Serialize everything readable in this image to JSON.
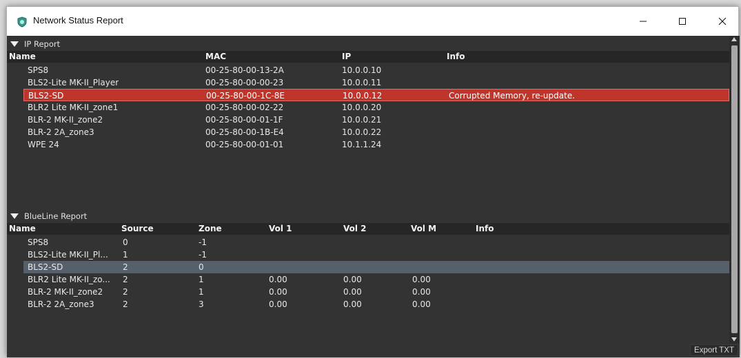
{
  "window": {
    "title": "Network Status Report",
    "icon": "network-shield-icon",
    "controls": {
      "minimize": "—",
      "maximize": "☐",
      "close": "✕"
    }
  },
  "ip_report": {
    "label": "IP Report",
    "columns": {
      "name": "Name",
      "mac": "MAC",
      "ip": "IP",
      "info": "Info"
    },
    "rows": [
      {
        "name": "SPS8",
        "mac": "00-25-80-00-13-2A",
        "ip": "10.0.0.10",
        "info": ""
      },
      {
        "name": "BLS2-Lite MK-II_Player",
        "mac": "00-25-80-00-00-23",
        "ip": "10.0.0.11",
        "info": ""
      },
      {
        "name": "BLS2-SD",
        "mac": "00-25-80-00-1C-8E",
        "ip": "10.0.0.12",
        "info": "Corrupted Memory, re-update."
      },
      {
        "name": "BLR2 Lite MK-II_zone1",
        "mac": "00-25-80-00-02-22",
        "ip": "10.0.0.20",
        "info": ""
      },
      {
        "name": "BLR-2 MK-II_zone2",
        "mac": "00-25-80-00-01-1F",
        "ip": "10.0.0.21",
        "info": ""
      },
      {
        "name": "BLR-2 2A_zone3",
        "mac": "00-25-80-00-1B-E4",
        "ip": "10.0.0.22",
        "info": ""
      },
      {
        "name": "WPE 24",
        "mac": "00-25-80-00-01-01",
        "ip": "10.1.1.24",
        "info": ""
      }
    ],
    "error_color": "#c0352b"
  },
  "blueline_report": {
    "label": "BlueLine Report",
    "columns": {
      "name": "Name",
      "source": "Source",
      "zone": "Zone",
      "vol1": "Vol 1",
      "vol2": "Vol 2",
      "volm": "Vol M",
      "info": "Info"
    },
    "rows": [
      {
        "name": "SPS8",
        "source": "0",
        "zone": "-1",
        "vol1": "",
        "vol2": "",
        "volm": "",
        "info": ""
      },
      {
        "name": "BLS2-Lite MK-II_Pl...",
        "source": "1",
        "zone": "-1",
        "vol1": "",
        "vol2": "",
        "volm": "",
        "info": ""
      },
      {
        "name": "BLS2-SD",
        "source": "2",
        "zone": "0",
        "vol1": "",
        "vol2": "",
        "volm": "",
        "info": ""
      },
      {
        "name": "BLR2 Lite MK-II_zo...",
        "source": "2",
        "zone": "1",
        "vol1": "0.00",
        "vol2": "0.00",
        "volm": "0.00",
        "info": ""
      },
      {
        "name": "BLR-2 MK-II_zone2",
        "source": "2",
        "zone": "1",
        "vol1": "0.00",
        "vol2": "0.00",
        "volm": "0.00",
        "info": ""
      },
      {
        "name": "BLR-2 2A_zone3",
        "source": "2",
        "zone": "3",
        "vol1": "0.00",
        "vol2": "0.00",
        "volm": "0.00",
        "info": ""
      }
    ],
    "selected_color": "#55606b"
  },
  "footer": {
    "export_label": "Export TXT"
  }
}
